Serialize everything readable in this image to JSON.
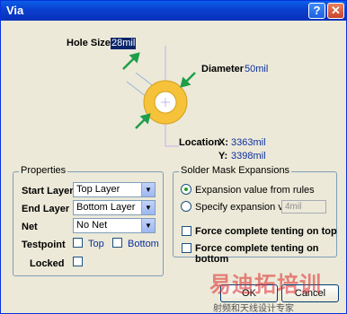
{
  "window": {
    "title": "Via",
    "help_label": "?",
    "close_label": "✕"
  },
  "diagram": {
    "hole_size_label": "Hole Size",
    "hole_size_value": "28mil",
    "diameter_label": "Diameter",
    "diameter_value": "50mil",
    "location_label": "Location",
    "x_label": "X:",
    "x_value": "3363mil",
    "y_label": "Y:",
    "y_value": "3398mil",
    "pad_color": "#f5c23a",
    "arrow_color": "#1e9e4a"
  },
  "properties": {
    "title": "Properties",
    "start_layer_label": "Start Layer",
    "start_layer_value": "Top Layer",
    "end_layer_label": "End Layer",
    "end_layer_value": "Bottom Layer",
    "net_label": "Net",
    "net_value": "No Net",
    "testpoint_label": "Testpoint",
    "top_label": "Top",
    "bottom_label": "Bottom",
    "locked_label": "Locked",
    "testpoint_top_checked": false,
    "testpoint_bottom_checked": false,
    "locked_checked": false
  },
  "solder_mask": {
    "title": "Solder Mask Expansions",
    "option_rules": "Expansion value from rules",
    "option_specify": "Specify expansion value",
    "specify_value": "4mil",
    "selected": "rules",
    "force_top": "Force complete tenting on top",
    "force_bottom": "Force complete tenting on bottom"
  },
  "buttons": {
    "ok": "OK",
    "cancel": "Cancel"
  },
  "watermark": {
    "main": "易迪拓培训",
    "sub": "射频和天线设计专家"
  }
}
